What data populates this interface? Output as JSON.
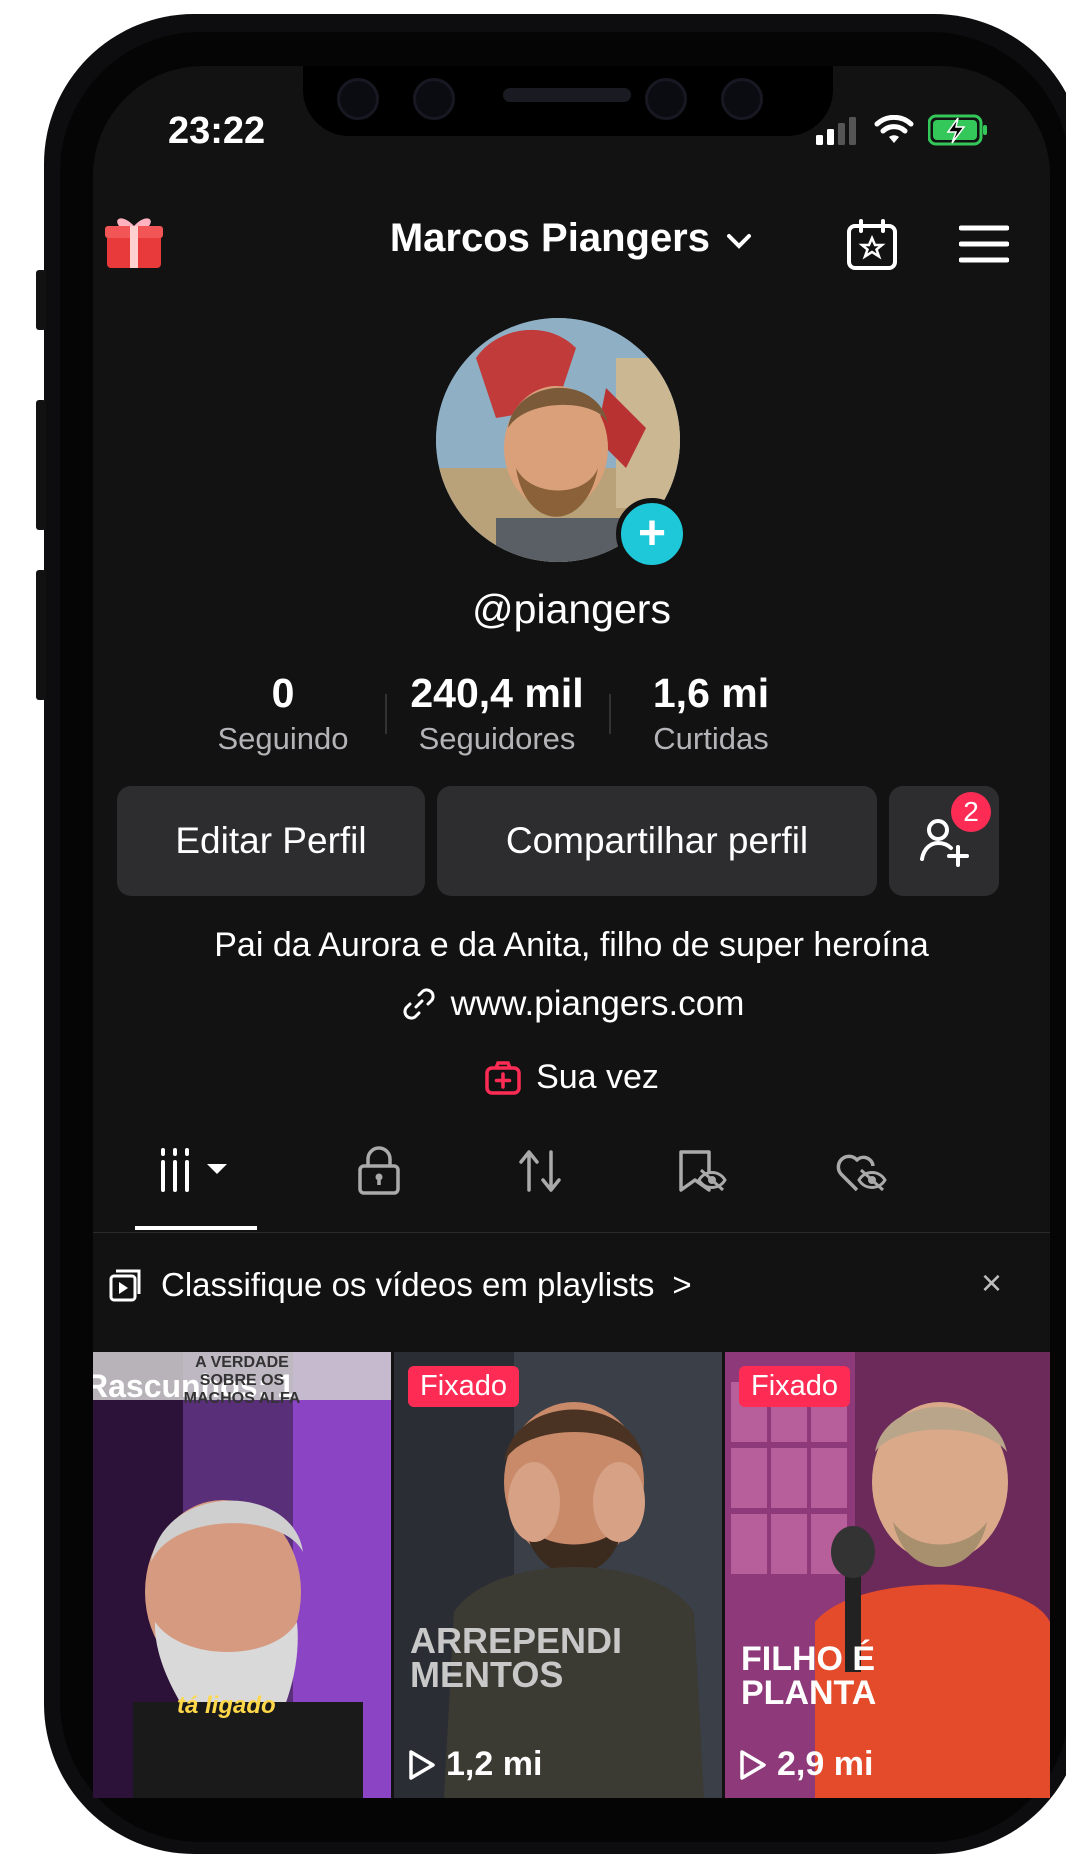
{
  "status_bar": {
    "time": "23:22"
  },
  "header": {
    "account_name": "Marcos Piangers"
  },
  "profile": {
    "handle": "@piangers",
    "stats": [
      {
        "value": "0",
        "label": "Seguindo"
      },
      {
        "value": "240,4 mil",
        "label": "Seguidores"
      },
      {
        "value": "1,6 mi",
        "label": "Curtidas"
      }
    ],
    "edit_label": "Editar Perfil",
    "share_label": "Compartilhar perfil",
    "friend_requests_badge": "2",
    "bio": "Pai da Aurora e da Anita, filho de super heroína",
    "link": "www.piangers.com",
    "sua_vez": "Sua vez"
  },
  "playlist_prompt": {
    "text": "Classifique os vídeos em playlists",
    "chevron": ">",
    "close": "×"
  },
  "videos": [
    {
      "drafts_label": "Rascunhos: 1",
      "top_caption": "A VERDADE SOBRE OS MACHOS ALFA",
      "subtitle": "tá ligado"
    },
    {
      "pinned": "Fixado",
      "title_line1": "ARREPENDI",
      "title_line2": "MENTOS",
      "views": "1,2 mi"
    },
    {
      "pinned": "Fixado",
      "title_line1": "FILHO É",
      "title_line2": "PLANTA",
      "views": "2,9 mi"
    }
  ],
  "colors": {
    "background": "#121212",
    "accent_red": "#fe2c55",
    "accent_cyan": "#1fc8d8",
    "button_bg": "#2d2d30"
  }
}
